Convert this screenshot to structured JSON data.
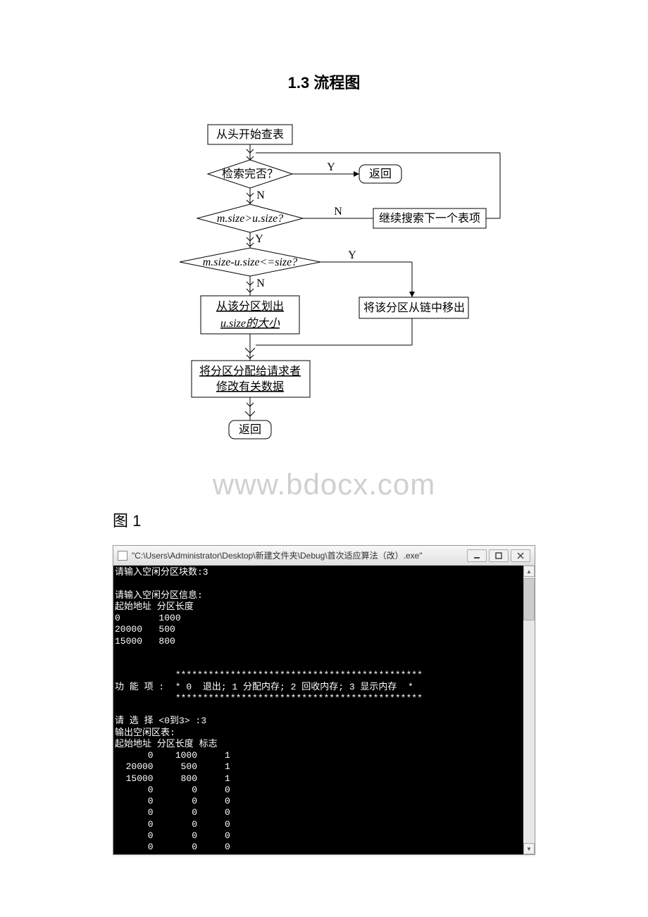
{
  "section_title": "1.3 流程图",
  "watermark": "www.bdocx.com",
  "figure_label": "图 1",
  "flowchart": {
    "start": "从头开始查表",
    "d1": "检索完否？",
    "d1_y": "Y",
    "d1_n": "N",
    "return1": "返回",
    "d2": "m.size>u.size?",
    "d2_n": "N",
    "d2_y": "Y",
    "continue_search": "继续搜索下一个表项",
    "d3": "m.size-u.size<=size?",
    "d3_y": "Y",
    "d3_n": "N",
    "remove_partition": "将该分区从链中移出",
    "allocate_usize1": "从该分区划出",
    "allocate_usize2": "u.size的大小",
    "assign1": "将分区分配给请求者",
    "assign2": "修改有关数据",
    "return2": "返回"
  },
  "terminal": {
    "title": "\"C:\\Users\\Administrator\\Desktop\\新建文件夹\\Debug\\首次适应算法（改）.exe\"",
    "minimize_icon": "minimize-icon",
    "maximize_icon": "maximize-icon",
    "close_icon": "close-icon",
    "body": "请输入空闲分区块数:3\n\n请输入空闲分区信息:\n起始地址 分区长度\n0       1000\n20000   500\n15000   800\n\n\n           *********************************************\n功 能 项 :  * 0  退出; 1 分配内存; 2 回收内存; 3 显示内存  *\n           *********************************************\n\n请 选 择 <0到3> :3\n输出空闲区表:\n起始地址 分区长度 标志\n      0    1000     1\n  20000     500     1\n  15000     800     1\n      0       0     0\n      0       0     0\n      0       0     0\n      0       0     0\n      0       0     0\n      0       0     0"
  }
}
